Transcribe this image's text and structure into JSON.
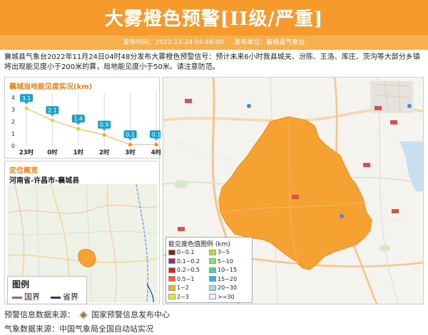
{
  "header": {
    "title": "大雾橙色预警[II级/严重]",
    "publish_time_label": "发布时间：2022-11-24 04:48:00",
    "publish_unit_label": "发布单位：襄城县气象台"
  },
  "description": "襄城县气象台2022年11月24日04时48分发布大雾橙色预警信号：预计未来6小时我县城关、汾陈、王洛、库庄、茨沟等大部分乡镇将出现能见度小于200米的雾，局地能见度小于50米。请注意防范。",
  "visibility_panel": {
    "title": "襄城当地能见度实况(km)"
  },
  "chart_data": {
    "type": "line",
    "title": "襄城当地能见度实况(km)",
    "categories": [
      "23时",
      "0时",
      "1时",
      "2时",
      "3时",
      "4时"
    ],
    "values": [
      3.1,
      2.1,
      1.4,
      0.9,
      0.1,
      0.1
    ],
    "value_labels": [
      "3.1",
      "2.1",
      "1.4",
      "0.9",
      "0.1",
      "0.1"
    ],
    "y_ticks": [
      "0",
      "1",
      "2",
      "3",
      "4"
    ],
    "ylim": [
      0,
      4
    ],
    "point_colors": [
      "#c8d85a",
      "#d8d454",
      "#e9c83a",
      "#f3a33a",
      "#f08a30",
      "#f08a30"
    ],
    "label_color": "#1aa0c8"
  },
  "location_panel": {
    "title": "定位概览",
    "region": "河南省-许昌市-襄城县",
    "legend_title": "图例",
    "legend_items": [
      {
        "label": "国界",
        "color": "#c0506a"
      },
      {
        "label": "省界",
        "color": "#1b3c8c"
      }
    ]
  },
  "visibility_legend": {
    "title": "能见度色值图例 (km)",
    "items": [
      {
        "label": "0~0.1",
        "color": "#7a2a1a"
      },
      {
        "label": "3~5",
        "color": "#a8e040"
      },
      {
        "label": "0.1~0.2",
        "color": "#8a2a8a"
      },
      {
        "label": "5~10",
        "color": "#8ae26a"
      },
      {
        "label": "0.2~0.5",
        "color": "#e02020"
      },
      {
        "label": "10~15",
        "color": "#40d8a0"
      },
      {
        "label": "0.5~1",
        "color": "#f06020"
      },
      {
        "label": "15~20",
        "color": "#30b0e8"
      },
      {
        "label": "1~2",
        "color": "#f5b020"
      },
      {
        "label": "20~30",
        "color": "#a8d8f0"
      },
      {
        "label": "2~3",
        "color": "#e8e838"
      },
      {
        "label": ">=30",
        "color": "#f0f0f0"
      }
    ]
  },
  "map": {
    "fog_area_color": "#f5a233",
    "place_labels": []
  },
  "footer": {
    "warning_source_label": "预警信息数据来源：",
    "warning_source_name": "国家预警信息发布中心",
    "weather_source": "气象数据来源：中国气象局全国自动站实况"
  }
}
